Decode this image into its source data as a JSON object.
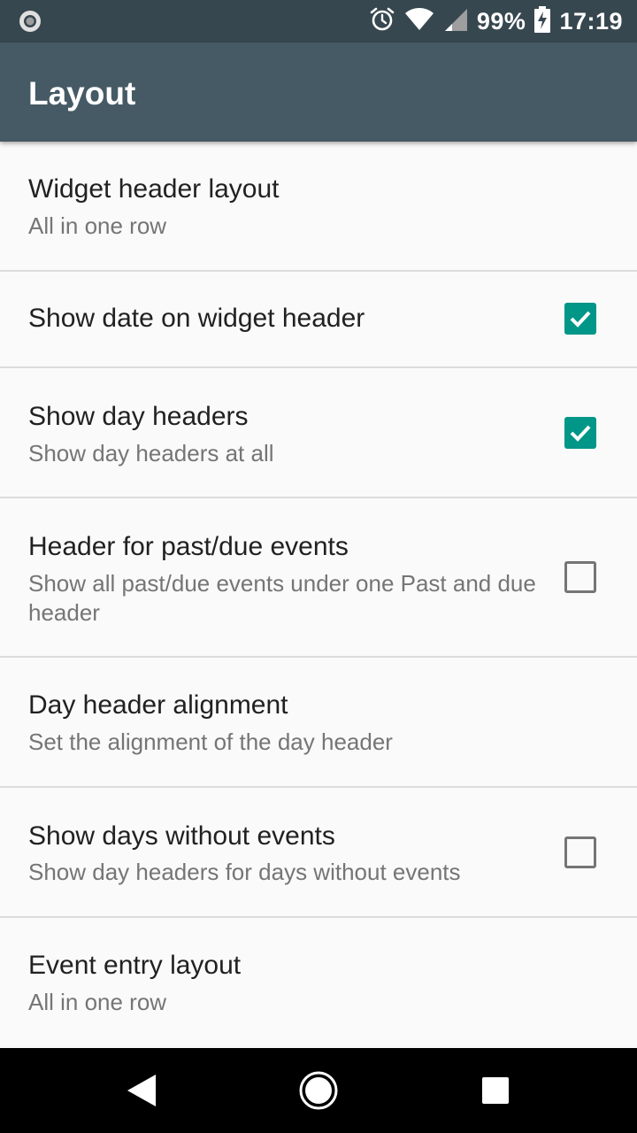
{
  "status_bar": {
    "battery": "99%",
    "time": "17:19",
    "icons": [
      "notification-dot-icon",
      "alarm-icon",
      "wifi-icon",
      "signal-icon",
      "battery-charging-icon"
    ]
  },
  "app_bar": {
    "title": "Layout"
  },
  "preferences": [
    {
      "title": "Widget header layout",
      "summary": "All in one row"
    },
    {
      "title": "Show date on widget header",
      "checked": true
    },
    {
      "title": "Show day headers",
      "summary": "Show day headers at all",
      "checked": true
    },
    {
      "title": "Header for past/due events",
      "summary": "Show all past/due events under one Past and due header",
      "checked": false
    },
    {
      "title": "Day header alignment",
      "summary": "Set the alignment of the day header"
    },
    {
      "title": "Show days without events",
      "summary": "Show day headers for days without events",
      "checked": false
    },
    {
      "title": "Event entry layout",
      "summary": "All in one row"
    }
  ],
  "nav_bar": {
    "buttons": [
      "back-icon",
      "home-icon",
      "recents-icon"
    ]
  },
  "colors": {
    "accent": "#009688",
    "app_bar": "#455a64",
    "status_bar": "#37474f"
  }
}
